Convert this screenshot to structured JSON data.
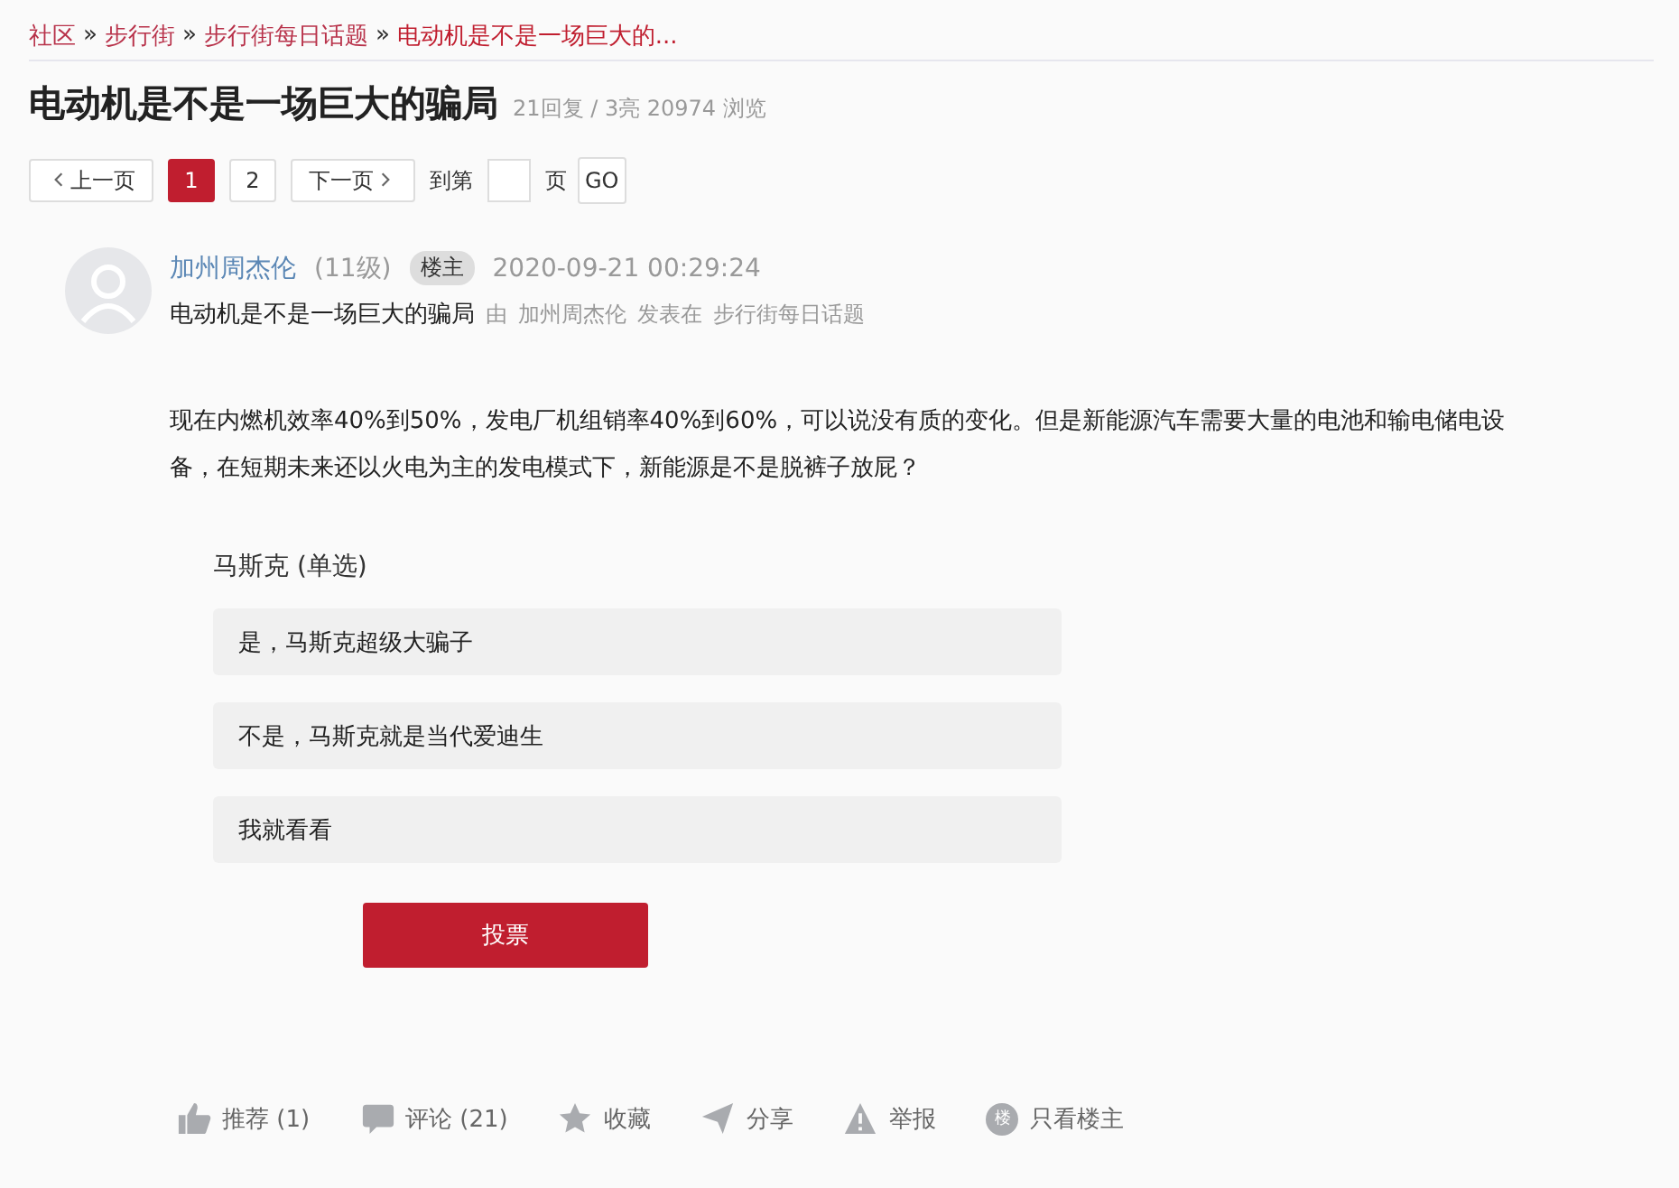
{
  "breadcrumb": [
    {
      "label": "社区",
      "current": false
    },
    {
      "label": "步行街",
      "current": false
    },
    {
      "label": "步行街每日话题",
      "current": false
    },
    {
      "label": "电动机是不是一场巨大的...",
      "current": true
    }
  ],
  "breadcrumb_separator": "»",
  "title": "电动机是不是一场巨大的骗局",
  "stats": "21回复 / 3亮 20974 浏览",
  "pagination": {
    "prev": "上一页",
    "pages": [
      {
        "label": "1",
        "selected": true
      },
      {
        "label": "2",
        "selected": false
      }
    ],
    "next": "下一页",
    "goto_label": "到第",
    "page_unit": "页",
    "go": "GO"
  },
  "post": {
    "author": "加州周杰伦",
    "level": "(11级)",
    "badge": "楼主",
    "time": "2020-09-21 00:29:24",
    "subject": "电动机是不是一场巨大的骗局",
    "by": "由",
    "by_author": "加州周杰伦",
    "posted_in": "发表在",
    "forum": "步行街每日话题",
    "body": "现在内燃机效率40%到50%，发电厂机组销率40%到60%，可以说没有质的变化。但是新能源汽车需要大量的电池和输电储电设备，在短期未来还以火电为主的发电模式下，新能源是不是脱裤子放屁？"
  },
  "poll": {
    "title": "马斯克 (单选)",
    "options": [
      {
        "label": "是，马斯克超级大骗子"
      },
      {
        "label": "不是，马斯克就是当代爱迪生"
      },
      {
        "label": "我就看看"
      }
    ],
    "button": "投票"
  },
  "actions": [
    {
      "kind": "like",
      "label": "推荐 (1)"
    },
    {
      "kind": "comment",
      "label": "评论 (21)"
    },
    {
      "kind": "star",
      "label": "收藏"
    },
    {
      "kind": "share",
      "label": "分享"
    },
    {
      "kind": "report",
      "label": "举报"
    },
    {
      "kind": "owner",
      "label": "只看楼主",
      "icon_text": "楼"
    }
  ]
}
